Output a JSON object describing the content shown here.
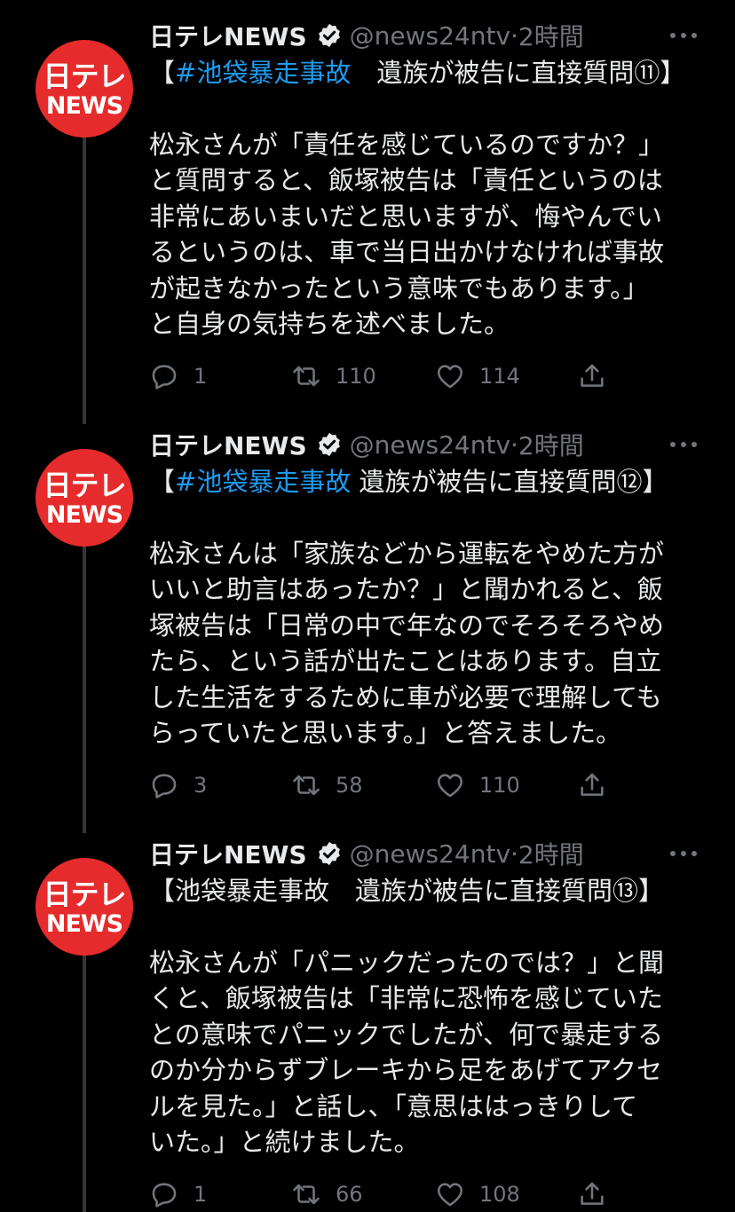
{
  "tweets": [
    {
      "author": {
        "name": "日テレNEWS",
        "handle": "@news24ntv",
        "separator": "·",
        "time": "2時間",
        "avatar_line1": "日テレ",
        "avatar_line2": "NEWS"
      },
      "title_open": "【",
      "hashtag": "#池袋暴走事故",
      "title_rest": "　遺族が被告に直接質問⑪】",
      "lines": [
        "松永さんが「責任を感じているのですか？」",
        "と質問すると、飯塚被告は「責任というのは",
        "非常にあいまいだと思いますが、悔やんでい",
        "るというのは、車で当日出かけなければ事故",
        "が起きなかったという意味でもあります。」",
        "と自身の気持ちを述べました。"
      ],
      "stats": {
        "replies": "1",
        "retweets": "110",
        "likes": "114"
      }
    },
    {
      "author": {
        "name": "日テレNEWS",
        "handle": "@news24ntv",
        "separator": "·",
        "time": "2時間",
        "avatar_line1": "日テレ",
        "avatar_line2": "NEWS"
      },
      "title_open": "【",
      "hashtag": "#池袋暴走事故",
      "title_rest": " 遺族が被告に直接質問⑫】",
      "lines": [
        "松永さんは「家族などから運転をやめた方が",
        "いいと助言はあったか？」と聞かれると、飯",
        "塚被告は「日常の中で年なのでそろそろやめ",
        "たら、という話が出たことはあります。自立",
        "した生活をするために車が必要で理解しても",
        "らっていたと思います。」と答えました。"
      ],
      "stats": {
        "replies": "3",
        "retweets": "58",
        "likes": "110"
      }
    },
    {
      "author": {
        "name": "日テレNEWS",
        "handle": "@news24ntv",
        "separator": "·",
        "time": "2時間",
        "avatar_line1": "日テレ",
        "avatar_line2": "NEWS"
      },
      "title_open": "【池袋暴走事故　遺族が被告に直接質問⑬】",
      "hashtag": "",
      "title_rest": "",
      "lines": [
        "松永さんが「パニックだったのでは？」と聞",
        "くと、飯塚被告は「非常に恐怖を感じていた",
        "との意味でパニックでしたが、何で暴走する",
        "のか分からずブレーキから足をあげてアクセ",
        "ルを見た。」と話し、「意思ははっきりして",
        "いた。」と続けました。"
      ],
      "stats": {
        "replies": "1",
        "retweets": "66",
        "likes": "108"
      }
    }
  ],
  "colors": {
    "background": "#000000",
    "text": "#e7e9ea",
    "muted": "#71767b",
    "link": "#1d9bf0",
    "brand_red": "#e52b2b"
  },
  "icons": [
    "verified-badge-icon",
    "more-icon",
    "reply-icon",
    "retweet-icon",
    "like-icon",
    "share-icon"
  ]
}
